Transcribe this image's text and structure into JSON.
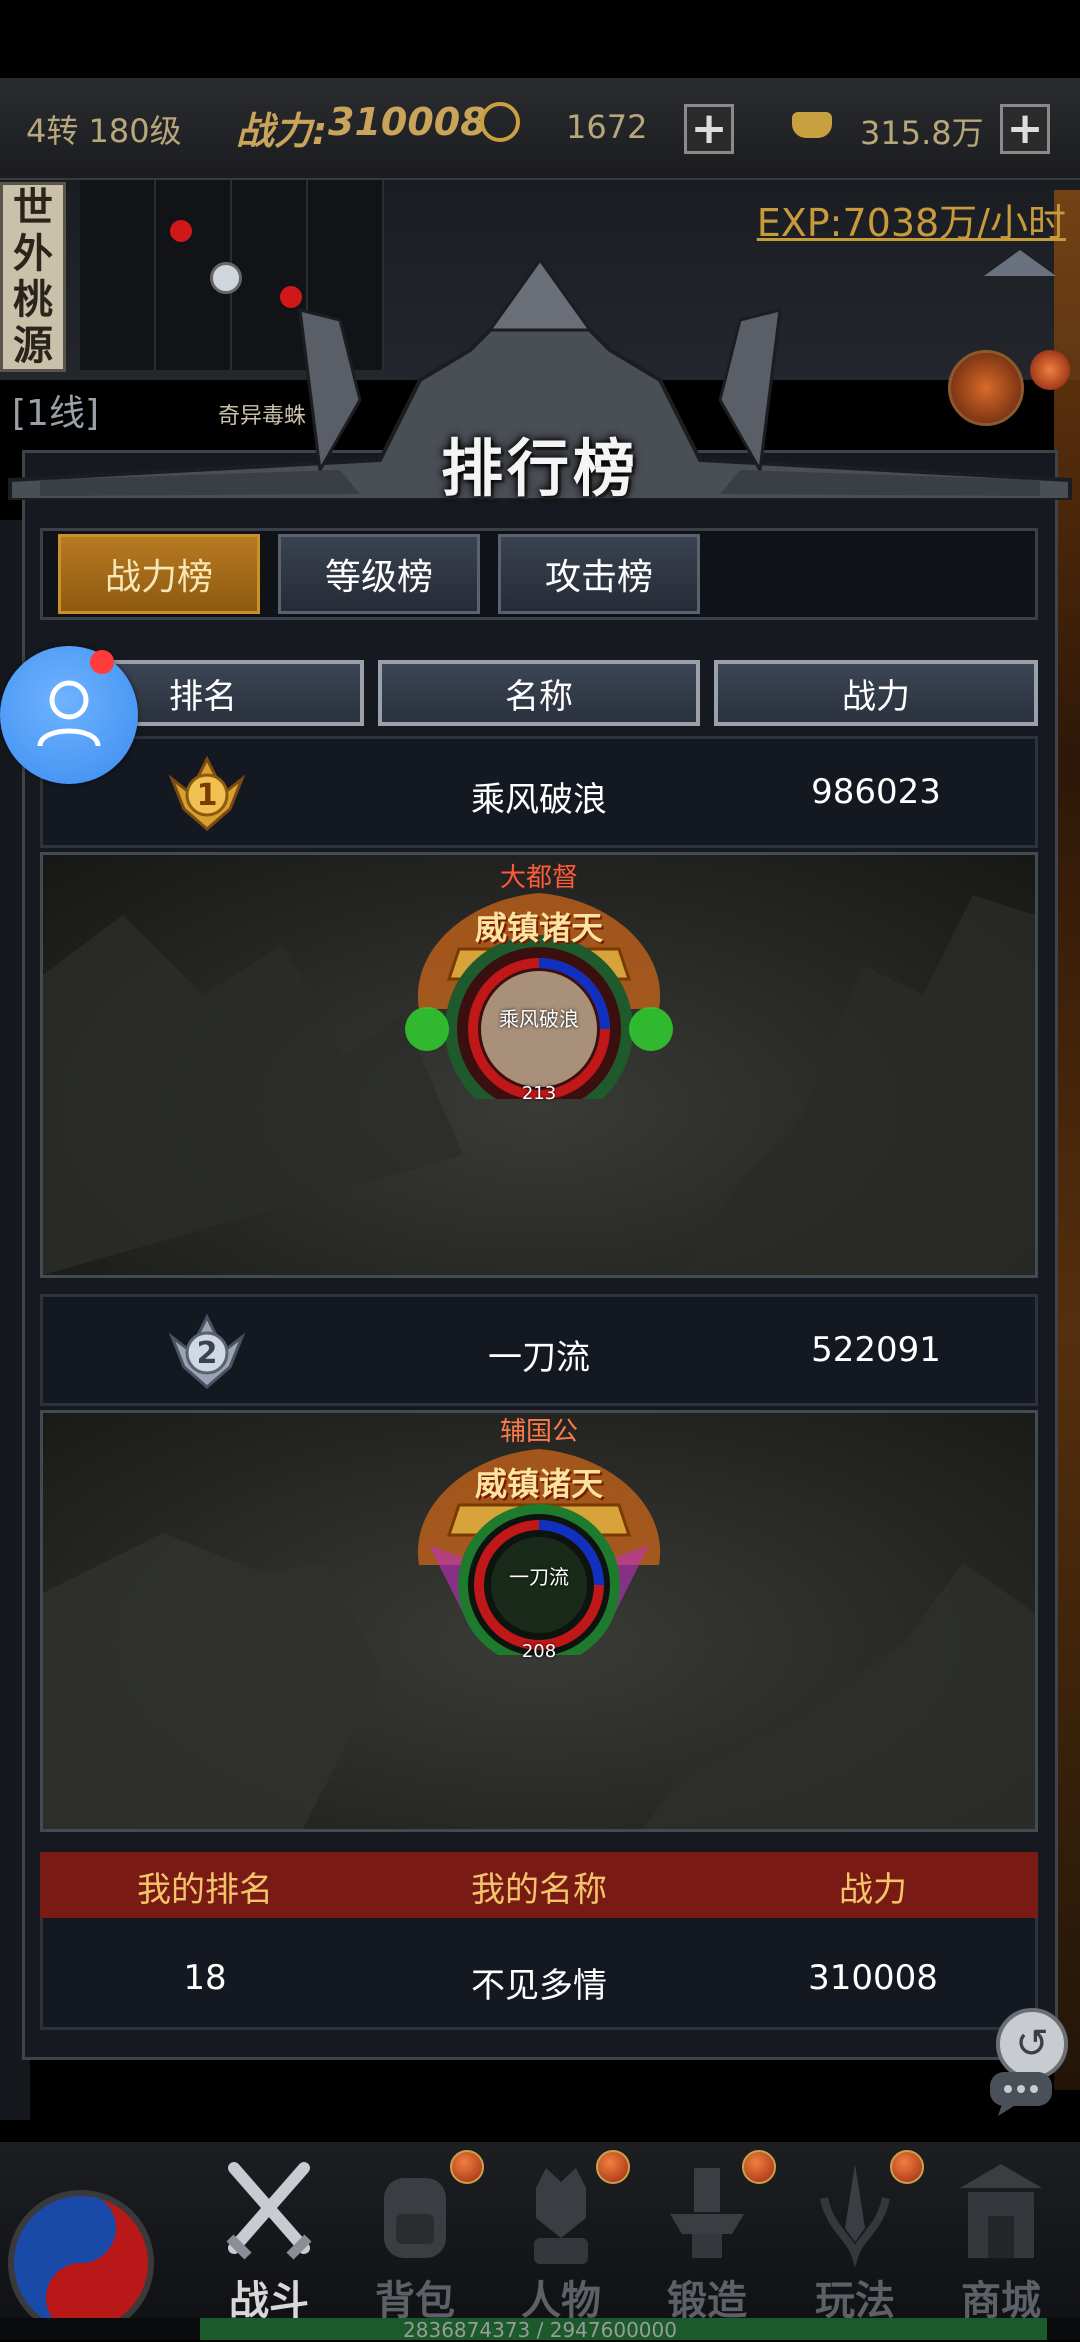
{
  "topbar": {
    "level": "4转 180级",
    "power_label": "战力:",
    "power_value": "310008",
    "coin_value": "1672",
    "gold_value": "315.8万"
  },
  "map": {
    "region_name": [
      "世",
      "外",
      "桃",
      "源"
    ],
    "exp_rate": "EXP:7038万/小时",
    "line": "[1线]",
    "monster_label": "奇异毒蛛"
  },
  "ranking": {
    "title": "排行榜",
    "tabs": [
      {
        "label": "战力榜",
        "active": true
      },
      {
        "label": "等级榜",
        "active": false
      },
      {
        "label": "攻击榜",
        "active": false
      }
    ],
    "headers": [
      "排名",
      "名称",
      "战力"
    ],
    "entries": [
      {
        "rank": "1",
        "name": "乘风破浪",
        "power": "986023",
        "rank_title": "大都督",
        "badge_title": "威镇诸天",
        "avatar_name": "乘风破浪",
        "avatar_level": "213"
      },
      {
        "rank": "2",
        "name": "一刀流",
        "power": "522091",
        "rank_title": "辅国公",
        "badge_title": "威镇诸天",
        "avatar_name": "一刀流",
        "avatar_level": "208"
      }
    ],
    "my_headers": [
      "我的排名",
      "我的名称",
      "战力"
    ],
    "my_row": {
      "rank": "18",
      "name": "不见多情",
      "power": "310008"
    }
  },
  "bottom_nav": [
    {
      "label": "战斗",
      "icon": "crossed-swords-icon",
      "active": true,
      "badge": false
    },
    {
      "label": "背包",
      "icon": "backpack-icon",
      "active": false,
      "badge": true
    },
    {
      "label": "人物",
      "icon": "character-icon",
      "active": false,
      "badge": true
    },
    {
      "label": "锻造",
      "icon": "anvil-icon",
      "active": false,
      "badge": true
    },
    {
      "label": "玩法",
      "icon": "sword-shield-icon",
      "active": false,
      "badge": true
    },
    {
      "label": "商城",
      "icon": "shop-gate-icon",
      "active": false,
      "badge": false
    }
  ],
  "exp_progress": {
    "text": "2836874373 / 2947600000",
    "fraction": 0.9624
  },
  "colors": {
    "active_tab": "#b77a1f",
    "my_rank_header": "#7a1a14",
    "my_rank_text": "#f3c46a",
    "exp_text": "#c79a3c"
  }
}
